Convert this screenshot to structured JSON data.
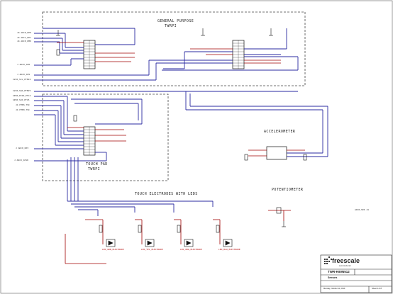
{
  "sections": {
    "general_purpose": {
      "title": "GENERAL PURPOSE",
      "sub": "TWRPI"
    },
    "touch_pad": {
      "title": "TOUCH PAD",
      "sub": "TWRPI"
    },
    "accelerometer": {
      "title": "ACCELEROMETER"
    },
    "potentiometer": {
      "title": "POTENTIOMETER"
    },
    "touch_electrodes": {
      "title": "TOUCH ELECTRODES WITH LEDS"
    }
  },
  "left_port_labels": [
    "J4 ADC0_DP0",
    "J4 ADC1_DP1",
    "J4 ADC0_DM0",
    "J  ADC0_SE8",
    "J  ADC0_SE9",
    "I2C0_SCL_PTE24",
    "I2C0_SDA_PTE25",
    "SPI0_PCS0_PTC4",
    "SPI0_SCK_PTC5",
    "J4  PTE6_TSI",
    "J4  PTE0_TSI",
    "J  ADC0_DP3",
    "J  ADC0_SE18"
  ],
  "right_port_label": "ADC0_SE6  J4",
  "led_labels": [
    "LED_GRN_ELECTRODE",
    "LED_YEL_ELECTRODE",
    "LED_ORG_ELECTRODE",
    "LED_BLU_ELECTRODE"
  ],
  "logo": {
    "name": "freescale",
    "tagline": "semiconductor"
  },
  "title_block": {
    "board": "TWR-K60N512",
    "page_title": "Sensors",
    "date": "Monday, October 11, 2010",
    "sheet": "Sheet 4 of 8"
  },
  "colors": {
    "bus": "#2a2aa0",
    "power": "#a00000",
    "outline": "#444444",
    "box": "#333333"
  }
}
